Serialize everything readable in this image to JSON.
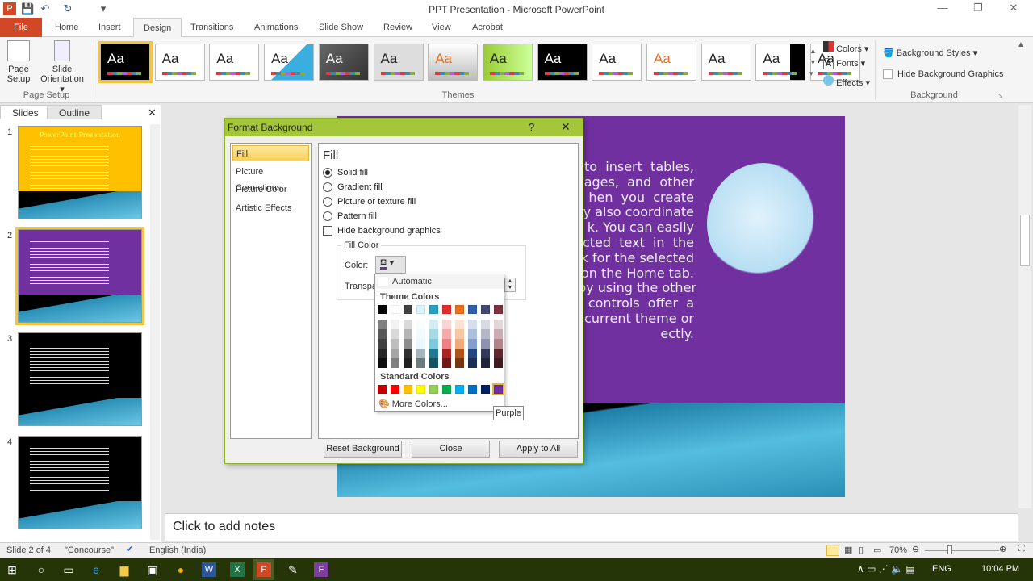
{
  "window": {
    "title": "PPT Presentation  -  Microsoft PowerPoint"
  },
  "tabs": [
    "File",
    "Home",
    "Insert",
    "Design",
    "Transitions",
    "Animations",
    "Slide Show",
    "Review",
    "View",
    "Acrobat"
  ],
  "active_tab": "Design",
  "ribbon": {
    "page_setup": {
      "page_setup_label": "Page Setup",
      "slide_orientation_label": "Slide Orientation",
      "group": "Page Setup"
    },
    "themes": {
      "group": "Themes",
      "sample": "Aa",
      "count": 14
    },
    "theme_options": {
      "colors": "Colors",
      "fonts": "Fonts",
      "effects": "Effects"
    },
    "background": {
      "styles": "Background Styles",
      "hide": "Hide Background Graphics",
      "group": "Background"
    }
  },
  "left_pane": {
    "tabs": [
      "Slides",
      "Outline"
    ],
    "slides": [
      {
        "num": "1",
        "bg": "#ffc000",
        "title": "PowerPoint Presentation"
      },
      {
        "num": "2",
        "bg": "#7030a0"
      },
      {
        "num": "3",
        "bg": "#000000"
      },
      {
        "num": "4",
        "bg": "#000000"
      }
    ],
    "selected": 2
  },
  "slide": {
    "bg": "#7030a0",
    "text": "to  insert  tables,\nages,  and  other\nhen  you  create\ny also coordinate\nk. You can easily\ncted  text  in  the\nk for the selected\non the Home tab.\nby using the other\ncontrols  offer  a\ncurrent theme or\nectly."
  },
  "notes": {
    "placeholder": "Click to add notes"
  },
  "dialog": {
    "title": "Format Background",
    "help": "?",
    "close": "✕",
    "nav": [
      "Fill",
      "Picture Corrections",
      "Picture Color",
      "Artistic Effects"
    ],
    "heading": "Fill",
    "options": [
      {
        "label": "Solid fill",
        "checked": true
      },
      {
        "label": "Gradient fill",
        "checked": false
      },
      {
        "label": "Picture or texture fill",
        "checked": false
      },
      {
        "label": "Pattern fill",
        "checked": false
      }
    ],
    "hide_graphics": "Hide background graphics",
    "fill_color_group": "Fill Color",
    "color_label": "Color:",
    "transparency_label": "Transpa",
    "buttons": [
      "Reset Background",
      "Close",
      "Apply to All"
    ]
  },
  "color_picker": {
    "automatic": "Automatic",
    "theme_heading": "Theme Colors",
    "standard_heading": "Standard Colors",
    "more": "More Colors...",
    "theme_colors": [
      "#000000",
      "#ffffff",
      "#404040",
      "#dbf3fb",
      "#2aa1c1",
      "#e32d2d",
      "#e8711f",
      "#2f5ea5",
      "#424a74",
      "#7a3540"
    ],
    "standard_colors": [
      "#c00000",
      "#ff0000",
      "#ffc000",
      "#ffff00",
      "#92d050",
      "#00b050",
      "#00b0f0",
      "#0070c0",
      "#002060",
      "#7030a0"
    ],
    "hovered": "Purple"
  },
  "status": {
    "slide": "Slide 2 of 4",
    "theme": "\"Concourse\"",
    "language": "English (India)",
    "zoom": "70%"
  },
  "taskbar": {
    "lang": "ENG",
    "time": "10:04 PM"
  }
}
